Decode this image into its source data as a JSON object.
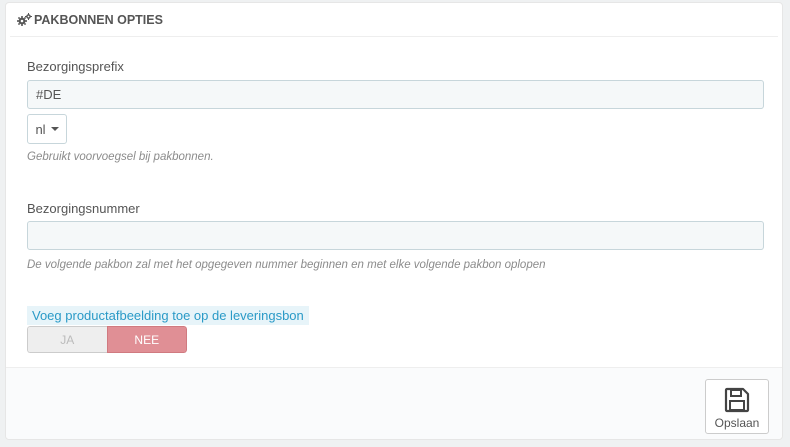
{
  "panel": {
    "title": "PAKBONNEN OPTIES",
    "title_icon": "cogs-icon"
  },
  "prefix": {
    "label": "Bezorgingsprefix",
    "value": "#DE",
    "language": "nl",
    "help": "Gebruikt voorvoegsel bij pakbonnen."
  },
  "number": {
    "label": "Bezorgingsnummer",
    "value": "",
    "help": "De volgende pakbon zal met het opgegeven nummer beginnen en met elke volgende pakbon oplopen"
  },
  "product_image": {
    "label": "Voeg productafbeelding toe op de leveringsbon",
    "yes_label": "JA",
    "no_label": "NEE",
    "selected": "NEE"
  },
  "footer": {
    "save_label": "Opslaan",
    "save_icon": "floppy-disk-icon"
  },
  "colors": {
    "toggle_off": "#e08f95",
    "label_highlight": "#2a9ac7",
    "input_background": "#f5f8f9"
  }
}
